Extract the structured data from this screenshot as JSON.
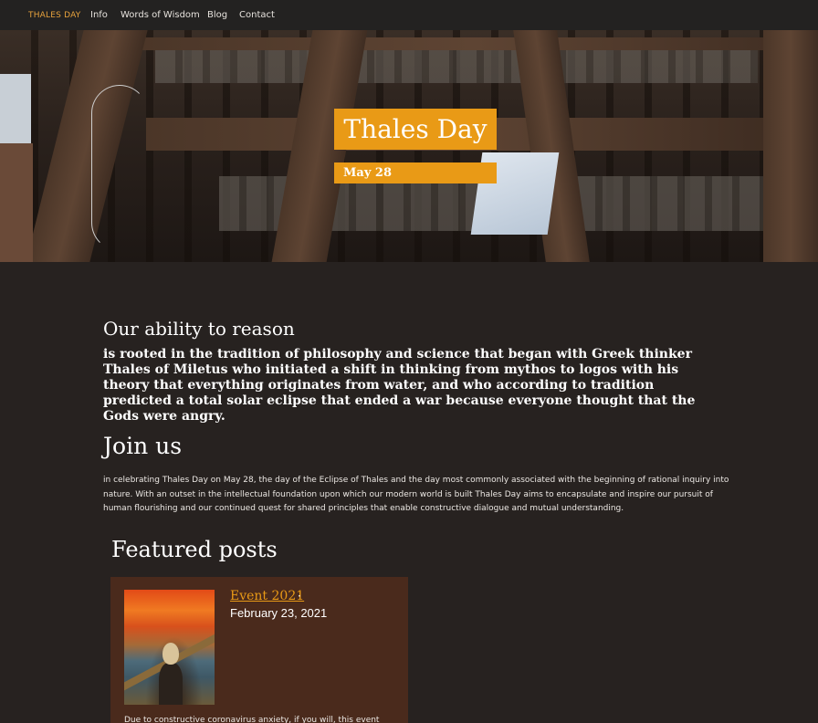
{
  "nav": {
    "brand": "THALES DAY",
    "items": [
      "Info",
      "Words of Wisdom",
      "Blog",
      "Contact"
    ]
  },
  "hero": {
    "title": "Thales Day",
    "date": "May 28"
  },
  "intro": {
    "heading": "Our ability to reason",
    "text": "is rooted in the tradition of philosophy and science that began with Greek thinker Thales of Miletus who initiated a shift in thinking from mythos to logos with his theory that everything originates from water, and who according to tradition predicted a total solar eclipse that ended a war because everyone thought that the Gods were angry."
  },
  "join": {
    "heading": "Join us",
    "text": "in celebrating Thales Day on May 28, the day of the Eclipse of Thales and the day most commonly associated with the beginning of rational inquiry into nature. With an outset in the intellectual foundation upon which our modern world is built Thales Day aims to encapsulate and inspire our pursuit of human flourishing and our continued quest for shared principles that enable constructive dialogue and mutual understanding."
  },
  "featured": {
    "heading": "Featured posts",
    "posts": [
      {
        "title": "Event 2021",
        "separator": "·",
        "date": "February 23, 2021",
        "excerpt": "Due to constructive coronavirus anxiety, if you will, this event"
      }
    ]
  },
  "colors": {
    "accent": "#e99a16",
    "background": "#272220",
    "nav_background": "#232221",
    "card_background": "#4a2a1c"
  }
}
